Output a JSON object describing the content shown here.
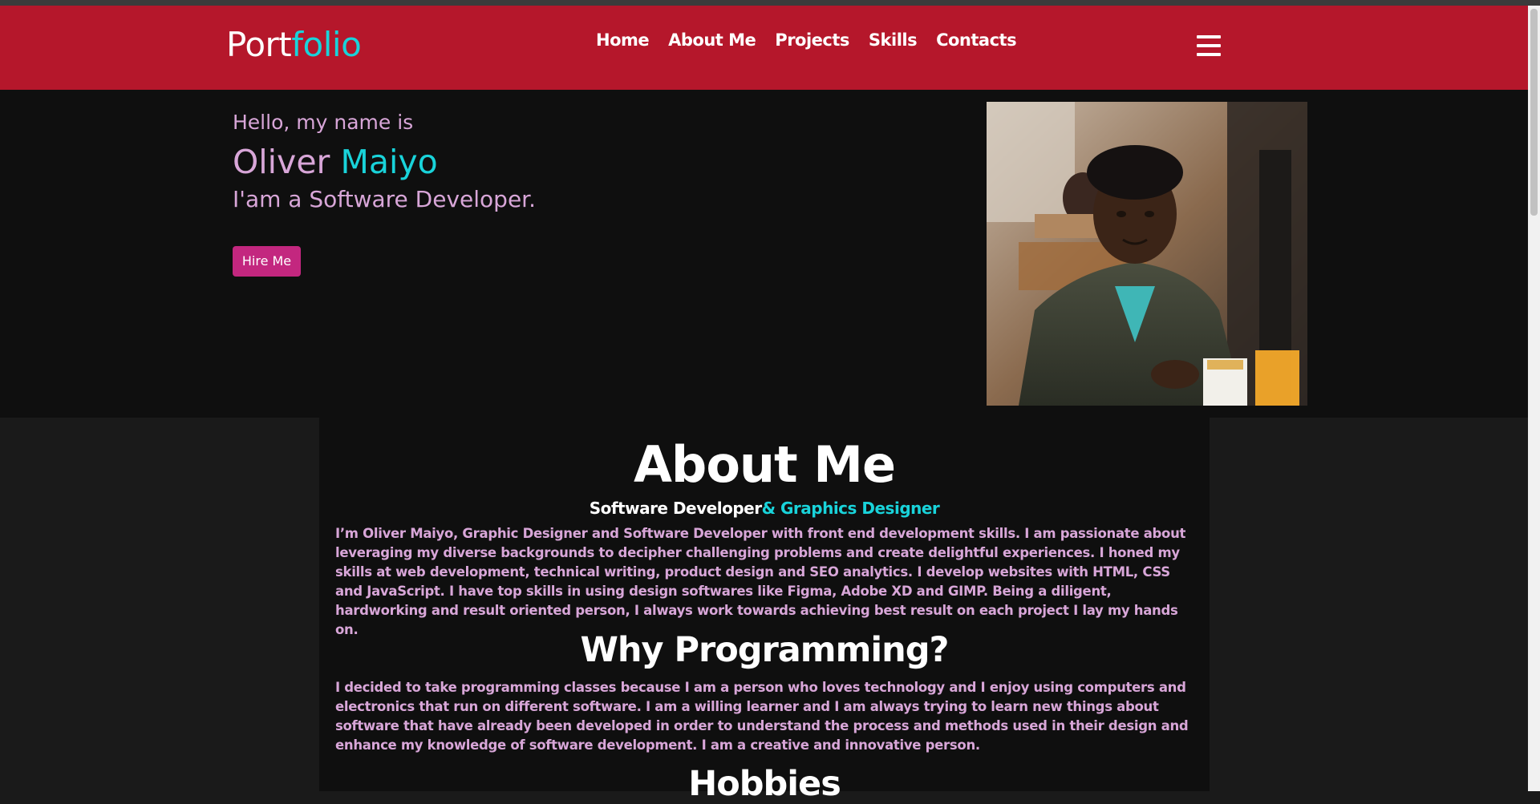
{
  "logo": {
    "part1": "Port",
    "part2": "folio"
  },
  "nav": {
    "items": [
      {
        "label": "Home"
      },
      {
        "label": "About Me"
      },
      {
        "label": "Projects"
      },
      {
        "label": "Skills"
      },
      {
        "label": "Contacts"
      }
    ]
  },
  "hero": {
    "greeting": "Hello, my name is",
    "first_name": "Oliver",
    "last_name": "Maiyo",
    "role": "I'am a Software Developer.",
    "hire_button": "Hire Me"
  },
  "about": {
    "title": "About Me",
    "subtitle_main": "Software Developer",
    "subtitle_accent": "& Graphics Designer",
    "paragraph": "I’m Oliver Maiyo, Graphic Designer and Software Developer with front end development skills. I am passionate about leveraging my diverse backgrounds to decipher challenging problems and create delightful experiences. I honed my skills at web development, technical writing, product design and SEO analytics. I develop websites with HTML, CSS and JavaScript. I have top skills in using design softwares like Figma, Adobe XD and GIMP. Being a diligent, hardworking and result oriented person, I always work towards achieving best result on each project I lay my hands on.",
    "why_title": "Why Programming?",
    "why_paragraph": "I decided to take programming classes because I am a person who loves technology and I enjoy using computers and electronics that run on different software. I am a willing learner and I am always trying to learn new things about software that have already been developed in order to understand the process and methods used in their design and enhance my knowledge of software development. I am a creative and innovative person.",
    "hobbies_title": "Hobbies"
  },
  "colors": {
    "nav_bg": "#b5172b",
    "accent": "#19d3da",
    "text_pink": "#d8a6d8",
    "button_bg": "#c3277f",
    "dark_bg": "#0f0f0f"
  },
  "icons": {
    "menu": "hamburger-menu-icon"
  }
}
